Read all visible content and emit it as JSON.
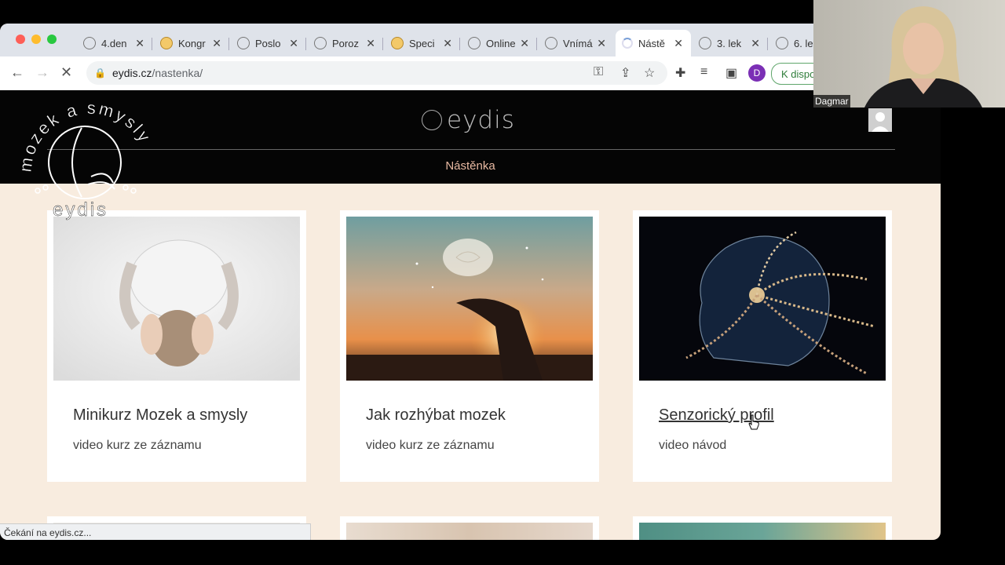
{
  "browser": {
    "tabs": [
      {
        "title": "4.den",
        "fav": "plain"
      },
      {
        "title": "Kongr",
        "fav": "yellow"
      },
      {
        "title": "Poslo",
        "fav": "plain"
      },
      {
        "title": "Poroz",
        "fav": "plain"
      },
      {
        "title": "Speci",
        "fav": "yellow"
      },
      {
        "title": "Online",
        "fav": "plain"
      },
      {
        "title": "Vnímá",
        "fav": "plain"
      },
      {
        "title": "Nástě",
        "fav": "loading",
        "active": true
      },
      {
        "title": "3. lek",
        "fav": "plain"
      },
      {
        "title": "6. le",
        "fav": "plain"
      }
    ],
    "close_glyph": "✕",
    "url_domain": "eydis.cz",
    "url_path": "/nastenka/",
    "profile_initial": "D",
    "availability_label": "K dispo",
    "status_text": "Čekání na eydis.cz..."
  },
  "site": {
    "logo_text": "eydis",
    "nav_label": "Nástěnka",
    "cards": [
      {
        "title": "Minikurz Mozek a smysly",
        "subtitle": "video kurz ze záznamu",
        "image": "person-holding-head-photo"
      },
      {
        "title": "Jak rozhýbat mozek",
        "subtitle": "video kurz ze záznamu",
        "image": "glowing-brain-hands-photo"
      },
      {
        "title": "Senzorický profil",
        "subtitle": "video návod",
        "image": "neural-head-art"
      }
    ]
  },
  "overlay": {
    "ring_text": "mozek a smysly",
    "brand": "eydis"
  },
  "webcam": {
    "name": "Dagmar"
  },
  "colors": {
    "page_bg": "#f8ecdf",
    "header_bg": "#050505",
    "nav_text": "#e8b9a2",
    "profile": "#7b2fb5",
    "availability": "#2f7d3a"
  }
}
